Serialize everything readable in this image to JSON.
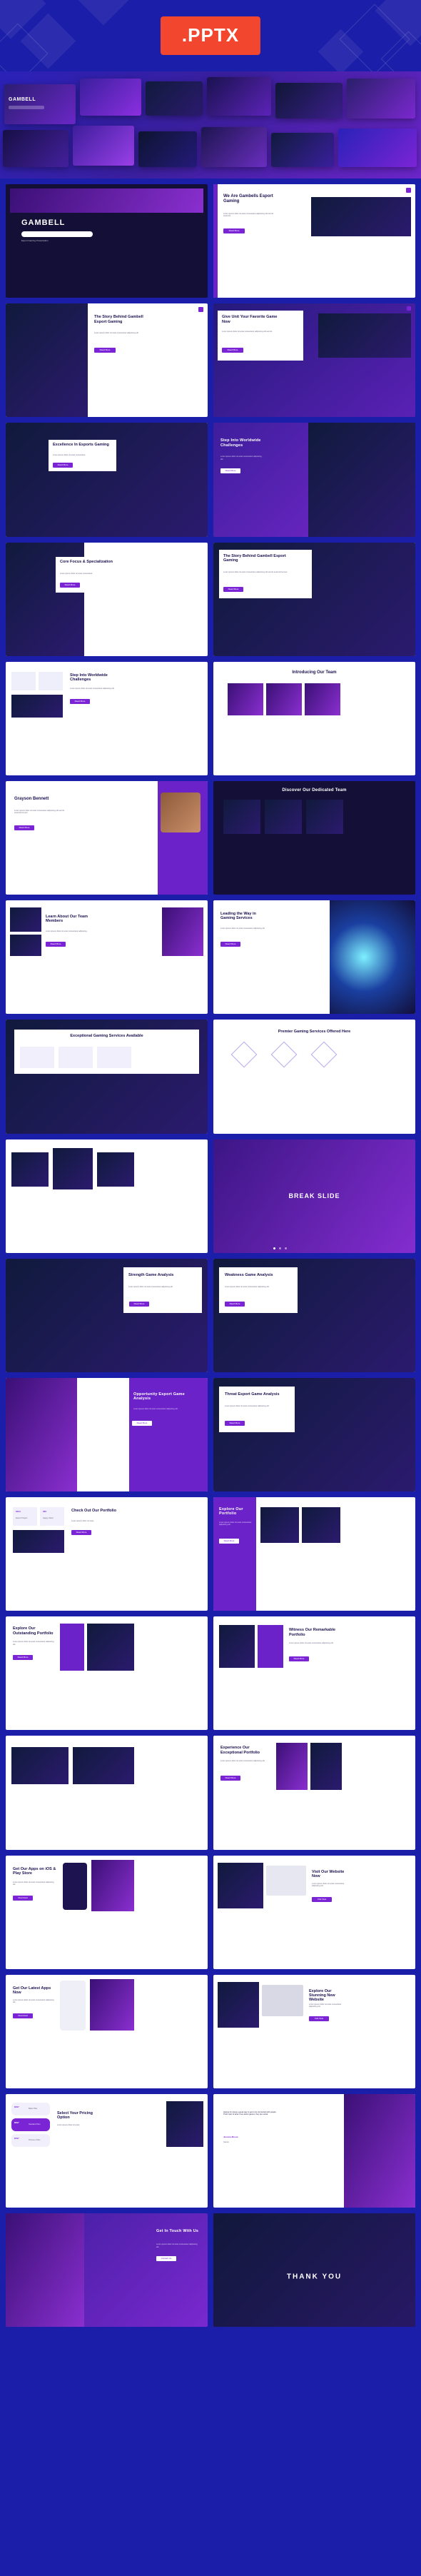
{
  "header": {
    "badge_label": ".PPTX",
    "badge_color": "#f2462f",
    "background_color": "#1b1ea8"
  },
  "hero": {
    "brand": "GAMBELL",
    "background_gradient": [
      "#2a21b8",
      "#6c25c9"
    ]
  },
  "theme": {
    "accent": "#7b24d6",
    "accent_light": "#8c2fe0",
    "dark": "#140f36",
    "page_bg": "#1b1ea8"
  },
  "slides": [
    {
      "id": 1,
      "layout": "cover-dark",
      "title": "GAMBELL",
      "subtitle": "Esport Gaming Presentation",
      "button": "",
      "brand": "GAMBELL"
    },
    {
      "id": 2,
      "layout": "intro-split",
      "title": "We Are Gambells Esport Gaming",
      "subtitle": "Lorem ipsum dolor sit amet consectetur adipiscing elit sed do eiusmod.",
      "button": "Read More"
    },
    {
      "id": 3,
      "layout": "story-left",
      "title": "The Story Behind Gambell Esport Gaming",
      "subtitle": "Lorem ipsum dolor sit amet consectetur adipiscing elit.",
      "button": "Read More"
    },
    {
      "id": 4,
      "layout": "story-right",
      "title": "Give Unit Your Favorite Game Now",
      "subtitle": "Lorem ipsum dolor sit amet consectetur adipiscing elit sed do.",
      "button": "Read More"
    },
    {
      "id": 5,
      "layout": "excellence",
      "title": "Excellence In Esports Gaming",
      "subtitle": "Lorem ipsum dolor sit amet consectetur.",
      "button": "Read More"
    },
    {
      "id": 6,
      "layout": "step-right",
      "title": "Step Into Worldwide Challenges",
      "subtitle": "Lorem ipsum dolor sit amet consectetur adipiscing elit.",
      "button": "Read More"
    },
    {
      "id": 7,
      "layout": "corefocus",
      "title": "Core Focus & Specialization",
      "subtitle": "Lorem ipsum dolor sit amet consectetur.",
      "button": "Read More"
    },
    {
      "id": 8,
      "layout": "story-card",
      "title": "The Story Behind Gambell Esport Gaming",
      "subtitle": "Lorem ipsum dolor sit amet consectetur adipiscing elit sed do eiusmod tempor.",
      "button": "Read More"
    },
    {
      "id": 9,
      "layout": "step-cards",
      "title": "Step Into Worldwide Challenges",
      "subtitle": "Lorem ipsum dolor sit amet consectetur adipiscing elit.",
      "button": "Read More"
    },
    {
      "id": 10,
      "layout": "team-intro",
      "title": "Introducing Our Team",
      "subtitle": "Lorem ipsum dolor sit amet consectetur adipiscing elit.",
      "button": ""
    },
    {
      "id": 11,
      "layout": "person-profile",
      "title": "Grayson Bennett",
      "subtitle": "Lorem ipsum dolor sit amet consectetur adipiscing elit sed do eiusmod tempor.",
      "button": "Read More"
    },
    {
      "id": 12,
      "layout": "dedicated-team",
      "title": "Discover Our Dedicated Team",
      "subtitle": "Lorem ipsum dolor sit amet consectetur adipiscing elit.",
      "button": ""
    },
    {
      "id": 13,
      "layout": "team-members",
      "title": "Learn About Our Team Members",
      "subtitle": "Lorem ipsum dolor sit amet consectetur adipiscing.",
      "button": "Read More"
    },
    {
      "id": 14,
      "layout": "leading-way",
      "title": "Leading the Way in Gaming Services",
      "subtitle": "Lorem ipsum dolor sit amet consectetur adipiscing elit.",
      "button": "Read More"
    },
    {
      "id": 15,
      "layout": "exceptional",
      "title": "Exceptional Gaming Services Available",
      "subtitle": "Lorem ipsum dolor sit amet consectetur adipiscing elit.",
      "button": ""
    },
    {
      "id": 16,
      "layout": "premier",
      "title": "Premier Gaming Services Offered Here",
      "subtitle": "Lorem ipsum dolor sit amet consectetur adipiscing elit.",
      "button": ""
    },
    {
      "id": 17,
      "layout": "gallery",
      "title": "",
      "subtitle": "",
      "button": ""
    },
    {
      "id": 18,
      "layout": "break",
      "title": "BREAK SLIDE",
      "subtitle": "",
      "button": ""
    },
    {
      "id": 19,
      "layout": "strength",
      "title": "Strength Game Analysis",
      "subtitle": "Lorem ipsum dolor sit amet consectetur adipiscing elit.",
      "button": "Read More"
    },
    {
      "id": 20,
      "layout": "weakness",
      "title": "Weakness Game Analysis",
      "subtitle": "Lorem ipsum dolor sit amet consectetur adipiscing elit.",
      "button": "Read More"
    },
    {
      "id": 21,
      "layout": "opportunity",
      "title": "Opportunity Esport Game Analysis",
      "subtitle": "Lorem ipsum dolor sit amet consectetur adipiscing elit.",
      "button": "Read More"
    },
    {
      "id": 22,
      "layout": "threat",
      "title": "Threat Esport Game Analysis",
      "subtitle": "Lorem ipsum dolor sit amet consectetur adipiscing elit.",
      "button": "Read More"
    },
    {
      "id": 23,
      "layout": "check-portfolio",
      "title": "Check Out Our Portfolio",
      "subtitle": "Lorem ipsum dolor sit amet.",
      "button": "Read More",
      "stats": [
        {
          "value": "2024",
          "label": "Esport Project"
        },
        {
          "value": "350",
          "label": "Happy Client"
        }
      ]
    },
    {
      "id": 24,
      "layout": "explore-portfolio",
      "title": "Explore Our Portfolio",
      "subtitle": "Lorem ipsum dolor sit amet consectetur adipiscing elit.",
      "button": "Read More"
    },
    {
      "id": 25,
      "layout": "outstanding",
      "title": "Explore Our Outstanding Portfolio",
      "subtitle": "Lorem ipsum dolor sit amet consectetur adipiscing elit.",
      "button": "Read More"
    },
    {
      "id": 26,
      "layout": "witness",
      "title": "Witness Our Remarkable Portfolio",
      "subtitle": "Lorem ipsum dolor sit amet consectetur adipiscing elit.",
      "button": "Read More"
    },
    {
      "id": 27,
      "layout": "portfolio-wide",
      "title": "",
      "subtitle": "",
      "button": ""
    },
    {
      "id": 28,
      "layout": "experience",
      "title": "Experience Our Exceptional Portfolio",
      "subtitle": "Lorem ipsum dolor sit amet consectetur adipiscing elit.",
      "button": "Read More"
    },
    {
      "id": 29,
      "layout": "apps-store",
      "title": "Get Our Apps on iOS & Play Store",
      "subtitle": "Lorem ipsum dolor sit amet consectetur adipiscing elit.",
      "button": "Download"
    },
    {
      "id": 30,
      "layout": "website",
      "title": "Visit Our Website Now",
      "subtitle": "Lorem ipsum dolor sit amet consectetur adipiscing elit.",
      "button": "Visit Now"
    },
    {
      "id": 31,
      "layout": "latest-apps",
      "title": "Get Our Latest Apps Now",
      "subtitle": "Lorem ipsum dolor sit amet consectetur adipiscing elit.",
      "button": "Download"
    },
    {
      "id": 32,
      "layout": "stunning-web",
      "title": "Explore Our Stunning New Website",
      "subtitle": "Lorem ipsum dolor sit amet consectetur adipiscing elit.",
      "button": "Visit Now"
    },
    {
      "id": 33,
      "layout": "pricing",
      "title": "Select Your Pricing Option",
      "subtitle": "Lorem ipsum dolor sit amet.",
      "button": "",
      "plans": [
        {
          "price": "$497",
          "name": "Basic Plan"
        },
        {
          "price": "$597",
          "name": "Standard Plan"
        },
        {
          "price": "$797",
          "name": "Premium Plan"
        }
      ]
    },
    {
      "id": 34,
      "layout": "testimonial",
      "title": "",
      "subtitle": "Having fun Gave a great way to get to be connected with people. That's part of what I love about games, they are social.",
      "button": "",
      "author": "Jessica Moore",
      "author_role": "Gamer"
    },
    {
      "id": 35,
      "layout": "contact",
      "title": "Get In Touch With Us",
      "subtitle": "Lorem ipsum dolor sit amet consectetur adipiscing elit.",
      "button": "Contact Us"
    },
    {
      "id": 36,
      "layout": "thankyou",
      "title": "THANK YOU",
      "subtitle": "",
      "button": ""
    }
  ]
}
